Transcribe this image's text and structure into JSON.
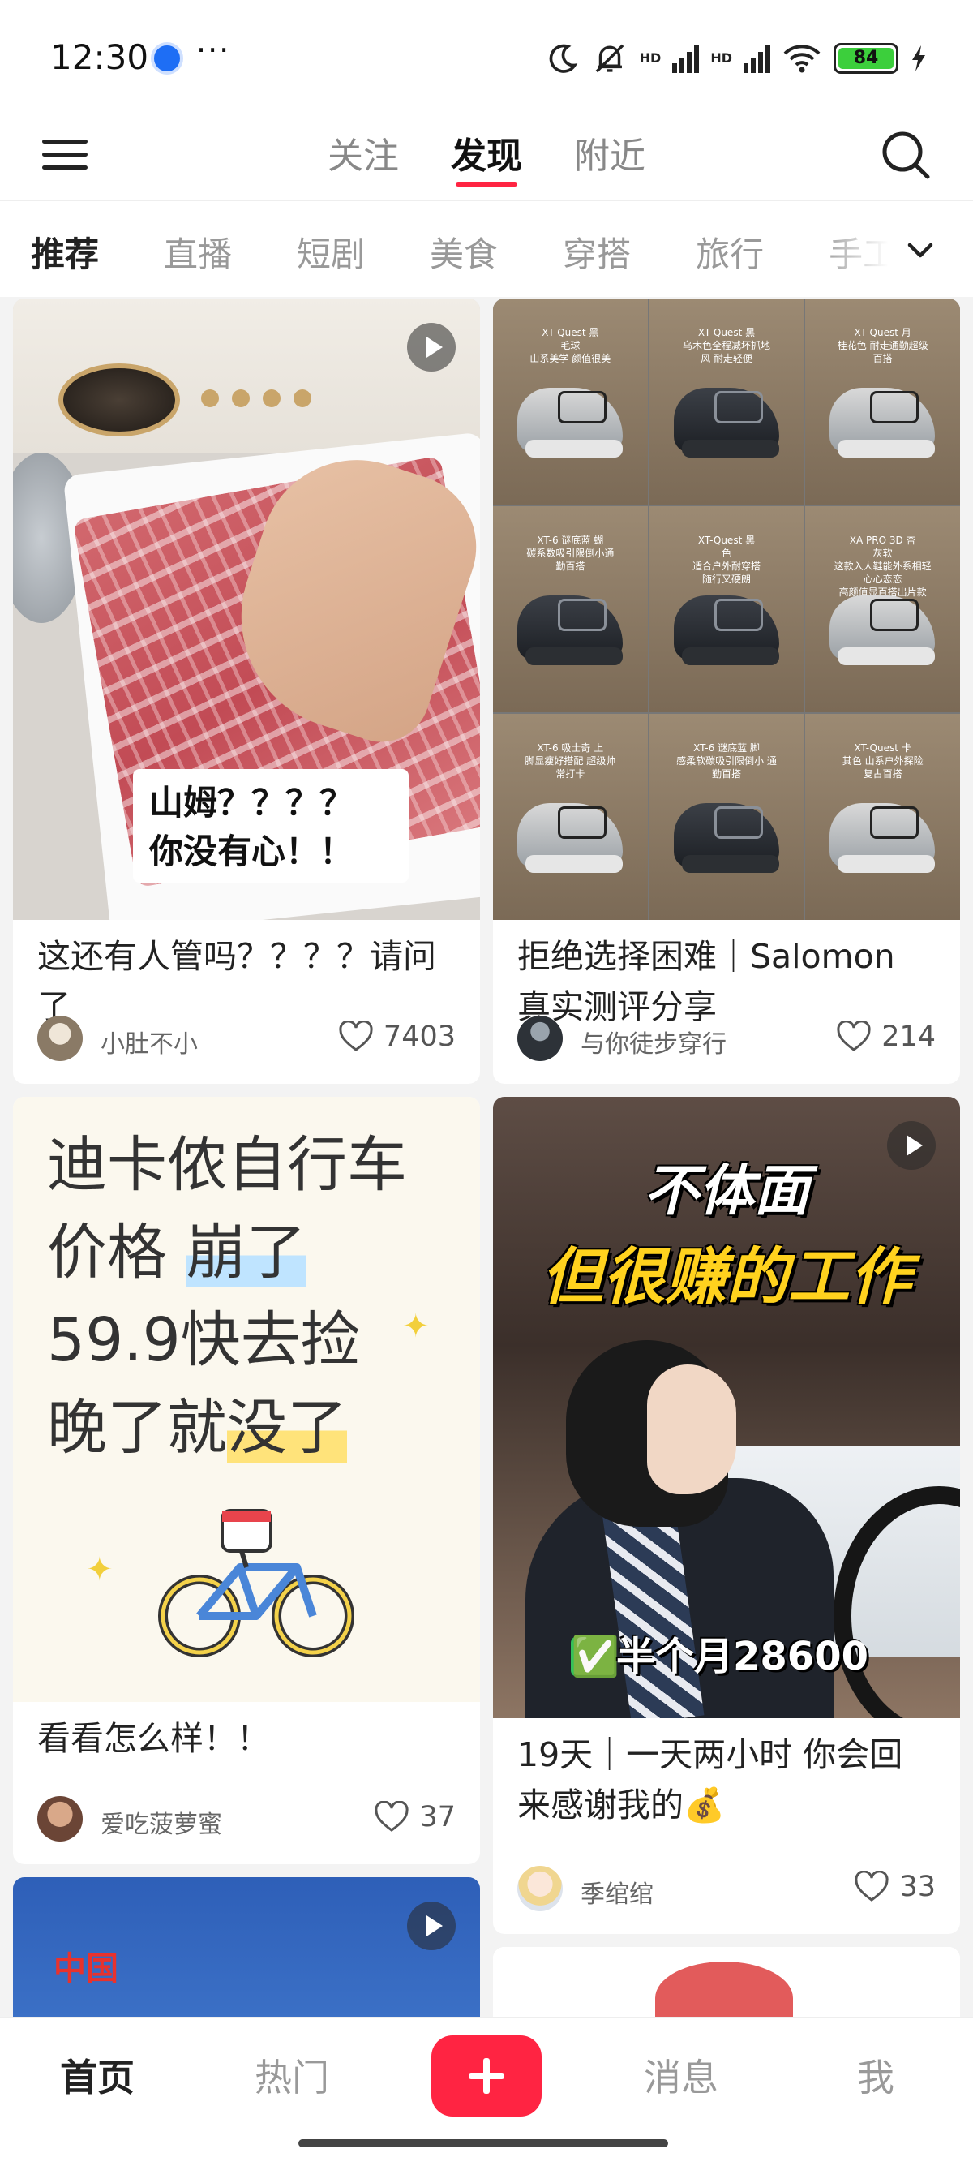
{
  "status_bar": {
    "time": "12:30",
    "more": "···",
    "battery": "84",
    "net1": "HD",
    "net2": "HD",
    "icons": [
      "app-notification-icon",
      "moon-icon",
      "mute-icon",
      "signal-icon",
      "signal-icon",
      "wifi-icon",
      "battery-icon",
      "charging-icon"
    ]
  },
  "top_nav": {
    "tabs": [
      "关注",
      "发现",
      "附近"
    ],
    "active_tab": "发现"
  },
  "categories": {
    "items": [
      "推荐",
      "直播",
      "短剧",
      "美食",
      "穿搭",
      "旅行",
      "手工"
    ],
    "active": "推荐"
  },
  "feed": {
    "cards": [
      {
        "title": "这还有人管吗？？？？请问了",
        "image_caption": [
          "山姆？？？？",
          "你没有心！！"
        ],
        "author": "小肚不小",
        "likes": "7403",
        "video": true
      },
      {
        "title": "拒绝选择困难｜Salomon 真实测评分享",
        "author": "与你徒步穿行",
        "likes": "214",
        "video": false,
        "shoe_labels": [
          "XT-Quest 黑\n毛球\n山系美学 颜值很美",
          "XT-Quest 黑\n乌木色全程减坏抓地\n风 耐走轻便",
          "XT-Quest 月\n桂花色 耐走通勤超级\n百搭",
          "XT-6 谜底蓝 蝴\n碳系数吸引限倒小通\n勤百搭",
          "XT-Quest 黑\n色\n适合户外耐穿搭\n随行又硬朗",
          "XA PRO 3D 杏\n灰软\n这款入人鞋能外系相轻\n心心恋恋\n高颜值显百搭出片款",
          "XT-6 吸士奇 上\n脚显瘦好搭配 超级帅\n常打卡",
          "XT-6 谜底蓝 脚\n感柔软碳吸引限倒小 通\n勤百搭",
          "XT-Quest 卡\n其色 山系户外探险\n复古百搭"
        ]
      },
      {
        "title": "看看怎么样！！",
        "image_text": [
          "迪卡侬自行车",
          "价格",
          "崩了",
          "59.9快去捡",
          "晚了就",
          "没了"
        ],
        "author": "爱吃菠萝蜜",
        "likes": "37",
        "video": false
      },
      {
        "title": "19天｜一天两小时 你会回来感谢我的💰",
        "image_text": [
          "不体面",
          "但很赚的工作",
          "✅",
          "半个月28600"
        ],
        "author": "季绾绾",
        "likes": "33",
        "video": true
      },
      {
        "image_text": "中国",
        "video": true
      }
    ]
  },
  "bottom_nav": {
    "items": [
      "首页",
      "热门",
      "消息",
      "我"
    ],
    "active": "首页",
    "publish": "+"
  }
}
